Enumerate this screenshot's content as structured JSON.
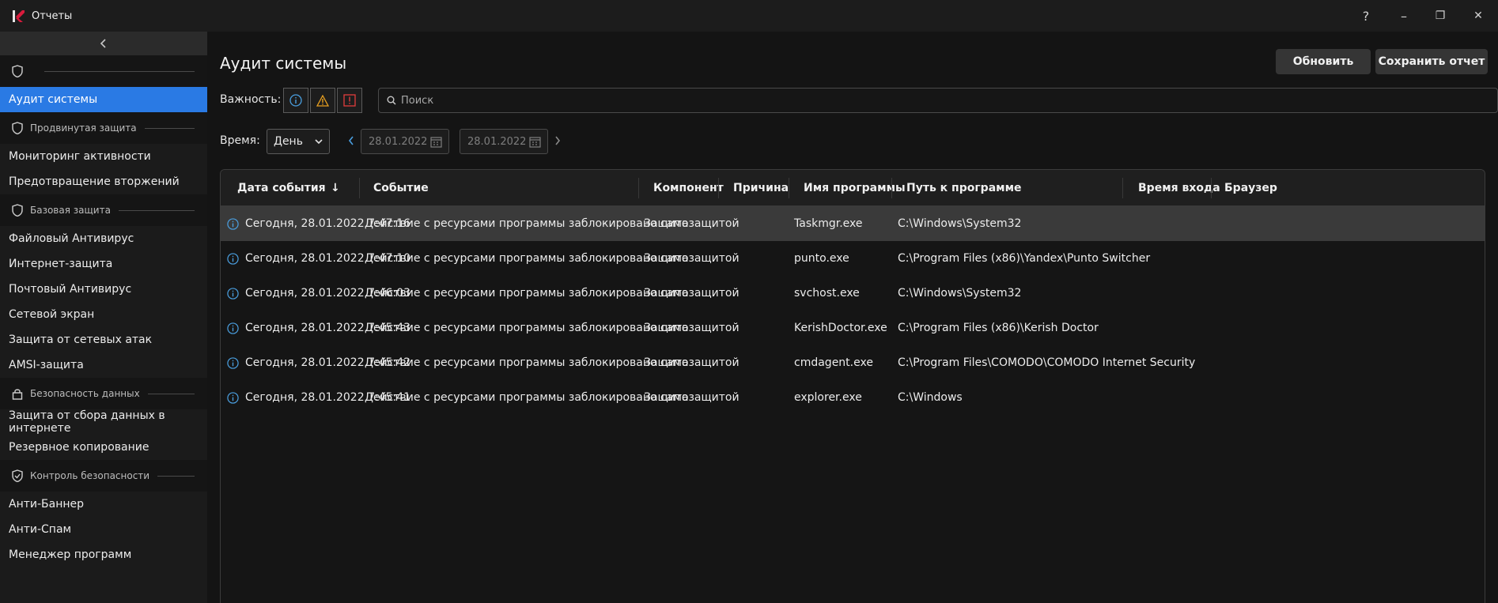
{
  "window": {
    "title": "Отчеты",
    "help": "?",
    "minimize": "–",
    "maximize": "❐",
    "close": "✕"
  },
  "sidebar": {
    "collapse_glyph": "‹",
    "sections": [
      {
        "title": "",
        "icon": "shield-icon",
        "items": [
          "Аудит системы"
        ]
      },
      {
        "title": "Продвинутая защита",
        "icon": "shield-icon",
        "items": [
          "Мониторинг активности",
          "Предотвращение вторжений"
        ]
      },
      {
        "title": "Базовая защита",
        "icon": "shield-icon",
        "items": [
          "Файловый Антивирус",
          "Интернет-защита",
          "Почтовый Антивирус",
          "Сетевой экран",
          "Защита от сетевых атак",
          "AMSI-защита"
        ]
      },
      {
        "title": "Безопасность данных",
        "icon": "lock-icon",
        "items": [
          "Защита от сбора данных в интернете",
          "Резервное копирование"
        ]
      },
      {
        "title": "Контроль безопасности",
        "icon": "shield-check-icon",
        "items": [
          "Анти-Баннер",
          "Анти-Спам",
          "Менеджер программ"
        ]
      }
    ],
    "active_item": "Аудит системы"
  },
  "main": {
    "title": "Аудит системы",
    "refresh_label": "Обновить",
    "save_label": "Сохранить отчет",
    "severity_label": "Важность:",
    "search_placeholder": "Поиск",
    "time_label": "Время:",
    "period_value": "День",
    "date_from": "28.01.2022",
    "date_to": "28.01.2022"
  },
  "colors": {
    "accent": "#2a7ae4",
    "info": "#4a9fe0",
    "warning": "#e8a020",
    "critical": "#e03c3c"
  },
  "table": {
    "columns": [
      "Дата события",
      "Событие",
      "Компонент",
      "Причина",
      "Имя программы",
      "Путь к программе",
      "Время входа",
      "Браузер"
    ],
    "sort_glyph": "↓",
    "rows": [
      {
        "date": "Сегодня, 28.01.2022 7:47:16",
        "event": "Действие с ресурсами программы заблокировано самозащитой",
        "component": "Защита",
        "reason": "",
        "program": "Taskmgr.exe",
        "path": "C:\\Windows\\System32",
        "login": "",
        "browser": ""
      },
      {
        "date": "Сегодня, 28.01.2022 7:47:10",
        "event": "Действие с ресурсами программы заблокировано самозащитой",
        "component": "Защита",
        "reason": "",
        "program": "punto.exe",
        "path": "C:\\Program Files (x86)\\Yandex\\Punto Switcher",
        "login": "",
        "browser": ""
      },
      {
        "date": "Сегодня, 28.01.2022 7:46:03",
        "event": "Действие с ресурсами программы заблокировано самозащитой",
        "component": "Защита",
        "reason": "",
        "program": "svchost.exe",
        "path": "C:\\Windows\\System32",
        "login": "",
        "browser": ""
      },
      {
        "date": "Сегодня, 28.01.2022 7:45:43",
        "event": "Действие с ресурсами программы заблокировано самозащитой",
        "component": "Защита",
        "reason": "",
        "program": "KerishDoctor.exe",
        "path": "C:\\Program Files (x86)\\Kerish Doctor",
        "login": "",
        "browser": ""
      },
      {
        "date": "Сегодня, 28.01.2022 7:45:42",
        "event": "Действие с ресурсами программы заблокировано самозащитой",
        "component": "Защита",
        "reason": "",
        "program": "cmdagent.exe",
        "path": "C:\\Program Files\\COMODO\\COMODO Internet Security",
        "login": "",
        "browser": ""
      },
      {
        "date": "Сегодня, 28.01.2022 7:45:41",
        "event": "Действие с ресурсами программы заблокировано самозащитой",
        "component": "Защита",
        "reason": "",
        "program": "explorer.exe",
        "path": "C:\\Windows",
        "login": "",
        "browser": ""
      }
    ],
    "selected_row": 0
  }
}
